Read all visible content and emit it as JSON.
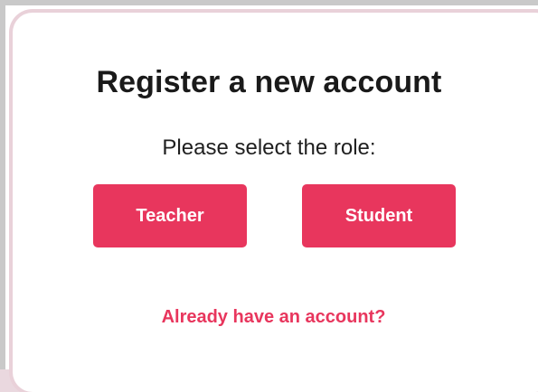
{
  "modal": {
    "title": "Register a new account",
    "subtitle": "Please select the role:",
    "buttons": [
      {
        "label": "Teacher"
      },
      {
        "label": "Student"
      }
    ],
    "login_link": "Already have an account?"
  },
  "colors": {
    "accent": "#e8365d",
    "backdrop": "#ead8df",
    "text": "#1a1a1a"
  }
}
